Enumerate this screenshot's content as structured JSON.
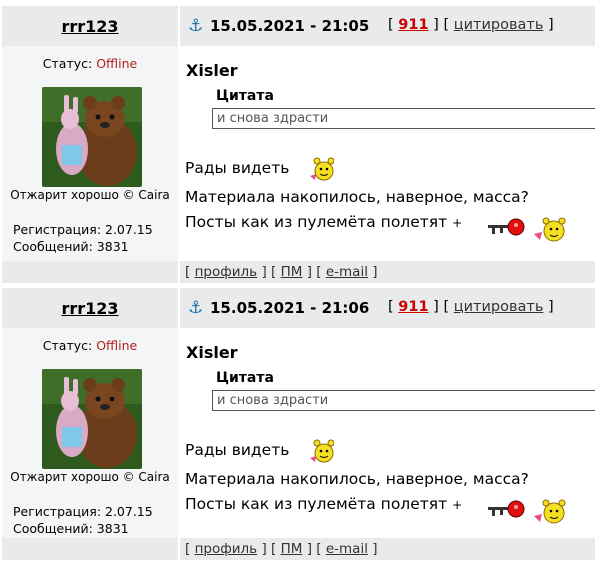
{
  "posts": [
    {
      "author": "rrr123",
      "status_label": "Статус:",
      "status_value": "Offline",
      "avatar_caption": "Отжарит хорошо © Caira",
      "registration": "Регистрация: 2.07.15",
      "messages": "Сообщений: 3831",
      "date": "15.05.2021 - 21:05",
      "post_number": "911",
      "quote_link": "цитировать",
      "quote_author": "Xisler",
      "quote_header": "Цитата",
      "quote_text": "и снова здрасти",
      "line1": "Рады видеть",
      "line2": "Материала накопилось, наверное, масса?",
      "line3": "Посты как из пулемёта полетят",
      "line3_plus": "+",
      "footer": {
        "profile": "профиль",
        "pm": "ПМ",
        "email": "e-mail"
      }
    },
    {
      "author": "rrr123",
      "status_label": "Статус:",
      "status_value": "Offline",
      "avatar_caption": "Отжарит хорошо © Caira",
      "registration": "Регистрация: 2.07.15",
      "messages": "Сообщений: 3831",
      "date": "15.05.2021 - 21:06",
      "post_number": "911",
      "quote_link": "цитировать",
      "quote_author": "Xisler",
      "quote_header": "Цитата",
      "quote_text": "и снова здрасти",
      "line1": "Рады видеть",
      "line2": "Материала накопилось, наверное, масса?",
      "line3": "Посты как из пулемёта полетят",
      "line3_plus": "+",
      "footer": {
        "profile": "профиль",
        "pm": "ПМ",
        "email": "e-mail"
      }
    }
  ],
  "brackets": {
    "open": "[",
    "close": "]"
  },
  "icons": {
    "anchor": "anchor-icon",
    "smiley_wave": "waving-smiley-icon",
    "smiley_gun": "machine-gun-icon"
  },
  "colors": {
    "header_bg": "#e8eaec",
    "status_offline": "#b02020",
    "post_number": "#cc0000",
    "anchor": "#1a6fa6"
  }
}
